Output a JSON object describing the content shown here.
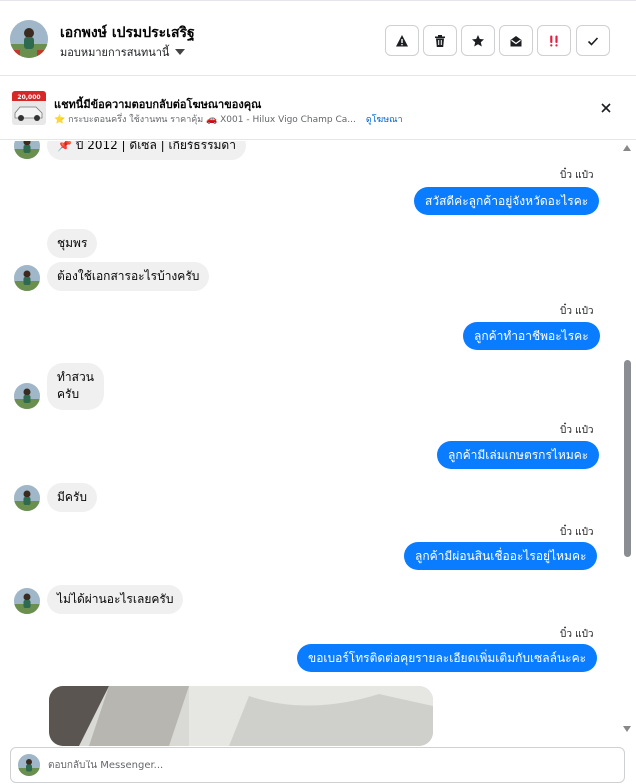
{
  "header": {
    "name": "เอกพงษ์ เปรมประเสริฐ",
    "assign_label": "มอบหมายการสนทนานี้",
    "buttons": [
      {
        "icon": "warning-icon",
        "label": "spam"
      },
      {
        "icon": "trash-icon",
        "label": "delete"
      },
      {
        "icon": "star-icon",
        "label": "star"
      },
      {
        "icon": "mark-unread-icon",
        "label": "mark unread"
      },
      {
        "icon": "follow-up-icon",
        "label": "follow up"
      },
      {
        "icon": "check-icon",
        "label": "done"
      }
    ]
  },
  "notice": {
    "title": "แชทนี้มีข้อความตอบกลับต่อโฆษณาของคุณ",
    "subtitle": "⭐ กระบะตอนครึ่ง ใช้งานทน ราคาคุ้ม 🚗 X001 - Hilux Vigo Champ Ca...",
    "link": "ดูโฆษณา",
    "thumb_badge": "20,000"
  },
  "messages": {
    "partial_top": "📌 ปี 2012 | ดีเซล | เกียร์ธรรมดา",
    "m1_sender": "บิ๋ว แป๋ว",
    "m1_text": "สวัสดีค่ะลูกค้าอยู่จังหวัดอะไรคะ",
    "m2_sender": "ชุมพร",
    "m2_text": "ต้องใช้เอกสารอะไรบ้างครับ",
    "m3_sender": "บิ๋ว แป๋ว",
    "m3_text": "ลูกค้าทำอาชีพอะไรคะ",
    "m4_line1": "ทำสวน",
    "m4_line2": "ครับ",
    "m5_sender": "บิ๋ว แป๋ว",
    "m5_text": "ลูกค้ามีเล่มเกษตรกรไหมคะ",
    "m6_text": "มีครับ",
    "m7_sender": "บิ๋ว แป๋ว",
    "m7_text": "ลูกค้ามีผ่อนสินเชื่ออะไรอยู่ไหมคะ",
    "m8_text": "ไม่ได้ผ่านอะไรเลยครับ",
    "m9_sender": "บิ๋ว แป๋ว",
    "m9_text": "ขอเบอร์โทรติดต่อคุยรายละเอียดเพิ่มเติมกับเซลล์นะคะ"
  },
  "composer": {
    "placeholder": "ตอบกลับใน Messenger..."
  },
  "colors": {
    "outgoing_bubble": "#0a7cff",
    "incoming_bubble": "#f0f0f0",
    "link": "#0064d1"
  }
}
